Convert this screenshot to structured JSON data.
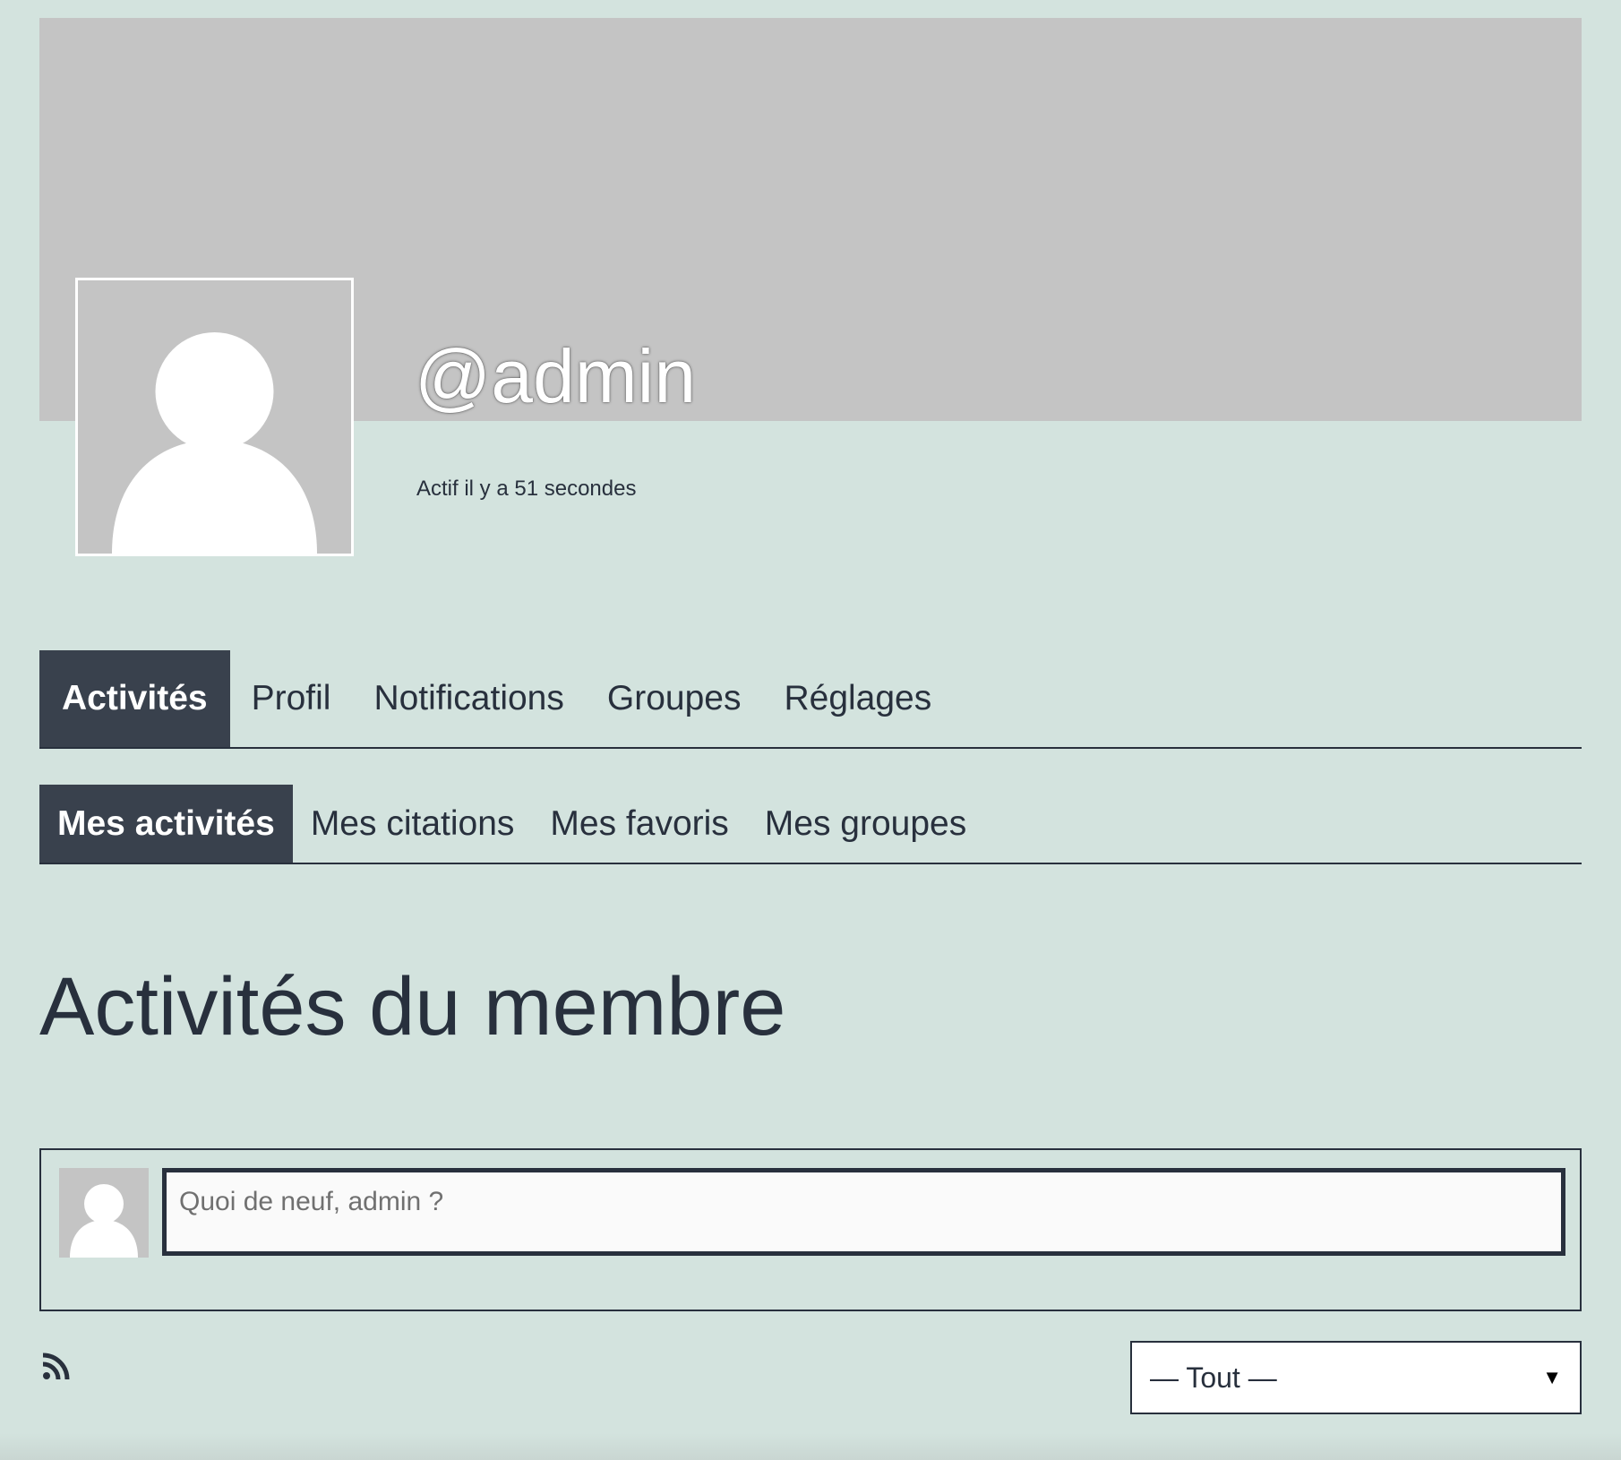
{
  "profile": {
    "username": "@admin",
    "last_active": "Actif il y a 51 secondes"
  },
  "main_nav": {
    "items": [
      {
        "label": "Activités",
        "active": true
      },
      {
        "label": "Profil",
        "active": false
      },
      {
        "label": "Notifications",
        "active": false
      },
      {
        "label": "Groupes",
        "active": false
      },
      {
        "label": "Réglages",
        "active": false
      }
    ]
  },
  "sub_nav": {
    "items": [
      {
        "label": "Mes activités",
        "active": true
      },
      {
        "label": "Mes citations",
        "active": false
      },
      {
        "label": "Mes favoris",
        "active": false
      },
      {
        "label": "Mes groupes",
        "active": false
      }
    ]
  },
  "page": {
    "title": "Activités du membre"
  },
  "post_form": {
    "placeholder": "Quoi de neuf, admin ?",
    "value": ""
  },
  "filter": {
    "selected": "— Tout —"
  },
  "icons": {
    "feed": "rss-icon",
    "avatar": "default-avatar-icon",
    "dropdown": "caret-down-icon"
  },
  "colors": {
    "background": "#d3e3de",
    "cover": "#c4c4c4",
    "active_tab": "#39414d",
    "text": "#28303d"
  }
}
